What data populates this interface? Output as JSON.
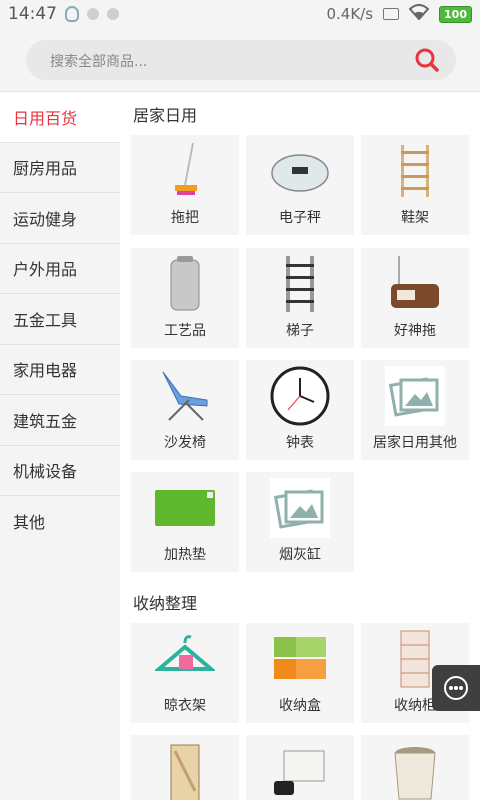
{
  "status": {
    "time": "14:47",
    "speed": "0.4K/s",
    "battery": "100"
  },
  "search": {
    "placeholder": "搜索全部商品..."
  },
  "sidebar": {
    "items": [
      "日用百货",
      "厨房用品",
      "运动健身",
      "户外用品",
      "五金工具",
      "家用电器",
      "建筑五金",
      "机械设备",
      "其他"
    ]
  },
  "sections": [
    {
      "title": "居家日用",
      "items": [
        "拖把",
        "电子秤",
        "鞋架",
        "工艺品",
        "梯子",
        "好神拖",
        "沙发椅",
        "钟表",
        "居家日用其他",
        "加热垫",
        "烟灰缸"
      ]
    },
    {
      "title": "收纳整理",
      "items": [
        "晾衣架",
        "收纳盒",
        "收纳柜"
      ]
    }
  ],
  "colors": {
    "accent": "#e8343a"
  }
}
